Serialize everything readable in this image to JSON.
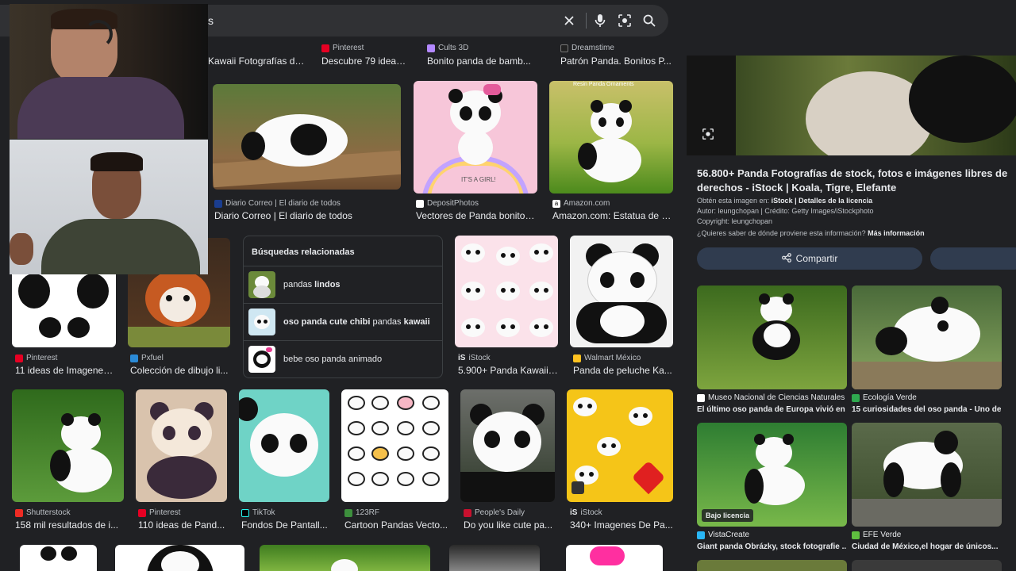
{
  "search": {
    "query_fragment": "s",
    "icons": [
      "close-icon",
      "mic-icon",
      "lens-icon",
      "search-icon"
    ]
  },
  "top_row": [
    {
      "title": "Kawaii Fotografías de..."
    },
    {
      "source": "Pinterest",
      "title": "Descubre 79 ideas ..."
    },
    {
      "source": "Cults 3D",
      "title": "Bonito panda de bamb..."
    },
    {
      "source": "Dreamstime",
      "title": "Patrón Panda. Bonitos P..."
    }
  ],
  "row1": [
    {
      "source": "Diario Correo | El diario de todos",
      "title": "Diario Correo | El diario de todos"
    },
    {
      "source": "DepositPhotos",
      "title": "Vectores de Panda bonito, ...",
      "caption": "IT'S A GIRL!"
    },
    {
      "source": "Amazon.com",
      "title": "Amazon.com: Estatua de p...",
      "caption": "Resin Panda Ornaments"
    }
  ],
  "row2": [
    {
      "source": "Pinterest",
      "title": "11 ideas de Imagenes..."
    },
    {
      "source": "Pxfuel",
      "title": "Colección de dibujo li..."
    },
    {
      "source": "iStock",
      "title": "5.900+ Panda Kawaii ..."
    },
    {
      "source": "Walmart México",
      "title": "Panda de peluche Ka..."
    }
  ],
  "related": {
    "heading": "Búsquedas relacionadas",
    "items": [
      {
        "prefix": "pandas ",
        "bold": "lindos",
        "suffix": ""
      },
      {
        "prefix": "",
        "bold": "oso panda cute chibi",
        "mid": " pandas ",
        "bold2": "kawaii"
      },
      {
        "prefix": "bebe oso panda animado",
        "bold": "",
        "suffix": ""
      }
    ]
  },
  "row3": [
    {
      "source": "Shutterstock",
      "title": "158 mil resultados de i..."
    },
    {
      "source": "Pinterest",
      "title": "110 ideas de Pand..."
    },
    {
      "source": "TikTok",
      "title": "Fondos De Pantall..."
    },
    {
      "source": "123RF",
      "title": "Cartoon Pandas Vecto..."
    },
    {
      "source": "People's Daily",
      "title": "Do you like cute pa..."
    },
    {
      "source": "iStock",
      "title": "340+ Imagenes De Pa..."
    }
  ],
  "panel": {
    "title": "56.800+ Panda Fotografías de stock, fotos e imágenes libres de derechos - iStock | Koala, Tigre, Elefante",
    "obtain_prefix": "Obtén esta imagen en: ",
    "obtain_link": "iStock | Detalles de la licencia",
    "author": "Autor: leungchopan | Crédito: Getty Images/iStockphoto",
    "copyright": "Copyright: leungchopan",
    "question": "¿Quieres saber de dónde proviene esta información? ",
    "question_link": "Más información",
    "share_label": "Compartir",
    "related": [
      {
        "source": "Museo Nacional de Ciencias Naturales",
        "title": "El último oso panda de Europa vivió en ..."
      },
      {
        "source": "Ecología Verde",
        "title": "15 curiosidades del oso panda - Uno de..."
      },
      {
        "source": "VistaCreate",
        "title": "Giant panda Obrázky, stock fotografie ...",
        "badge": "Bajo licencia"
      },
      {
        "source": "EFE Verde",
        "title": "Ciudad de México,el hogar de únicos..."
      }
    ]
  },
  "colors": {
    "background": "#202124",
    "surface": "#303134",
    "accent_button": "#303c4f"
  }
}
